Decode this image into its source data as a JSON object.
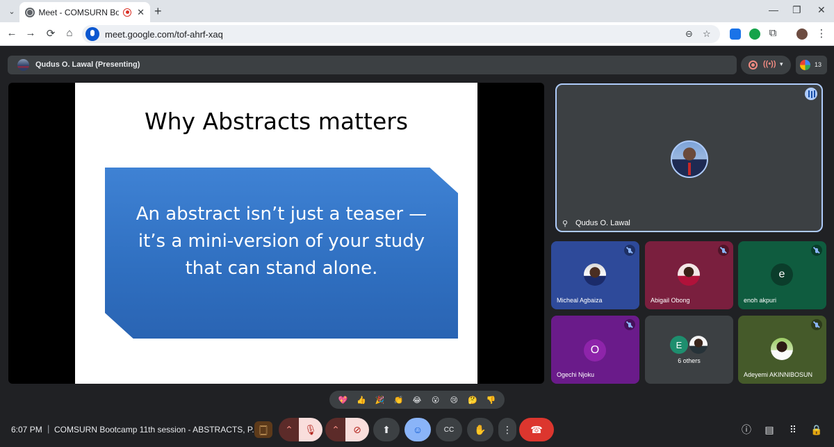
{
  "browser": {
    "tab_title": "Meet - COMSURN Bootcamp",
    "url": "meet.google.com/tof-ahrf-xaq",
    "icons": {
      "tab_search": "chevron-down-icon",
      "new_tab": "plus-icon",
      "back": "arrow-left-icon",
      "forward": "arrow-right-icon",
      "reload": "reload-icon",
      "home": "home-icon",
      "zoom": "zoom-icon",
      "bookmark": "star-icon",
      "extensions": "puzzle-icon",
      "menu": "kebab-icon"
    },
    "glyphs": {
      "chevron": "⌄",
      "close": "✕",
      "plus": "+",
      "minimize": "—",
      "restore": "❐",
      "back": "←",
      "forward": "→",
      "reload": "⟳",
      "home": "⌂",
      "zoom": "⊖",
      "star": "☆",
      "puzzle": "⧉",
      "kebab": "⋮"
    }
  },
  "meet": {
    "presenting_label": "Qudus O. Lawal (Presenting)",
    "participant_count": "13",
    "recording_glyphs": {
      "live": "((•))",
      "caret": "▾"
    },
    "slide": {
      "title": "Why Abstracts matters",
      "body_lines": [
        "An abstract isn’t just a teaser —",
        "it’s a mini-version of your study",
        "that can stand alone."
      ]
    },
    "main_tile": {
      "name": "Qudus O. Lawal",
      "pin_glyph": "⚲"
    },
    "tiles": [
      {
        "name": "Micheal Agbaiza",
        "type": "photo"
      },
      {
        "name": "Abigail Obong",
        "type": "photo"
      },
      {
        "name": "enoh akpuri",
        "type": "letter",
        "letter": "e"
      },
      {
        "name": "Ogechi Njoku",
        "type": "letter",
        "letter": "O"
      },
      {
        "name": "6 others",
        "type": "group",
        "letter": "E"
      },
      {
        "name": "Adeyemi AKINNIBOSUN",
        "type": "photo"
      }
    ],
    "reactions": [
      "💖",
      "👍",
      "🎉",
      "👏",
      "😂",
      "😮",
      "😢",
      "🤔",
      "👎"
    ],
    "bottom_bar": {
      "time": "6:07 PM",
      "separator": "|",
      "meeting_title": "COMSURN Bootcamp 11th session - ABSTRACTS, P...",
      "controls": {
        "live_captions": "🀆",
        "mic_options": "⌃",
        "mic_off": "🎙",
        "camera_options": "⌃",
        "camera_off": "⊘",
        "present": "⬆",
        "emoji": "☺",
        "captions": "CC",
        "raise_hand": "✋",
        "more": "⋮",
        "end_call": "☎"
      },
      "right": {
        "info": "ⓘ",
        "chat": "▤",
        "activities": "⠿",
        "host_controls": "🔒"
      }
    }
  },
  "colors": {
    "meet_background": "#202124",
    "slide_box": "#3f82d4",
    "end_call": "#dc362e",
    "active_tile_border": "#aecbfa"
  }
}
